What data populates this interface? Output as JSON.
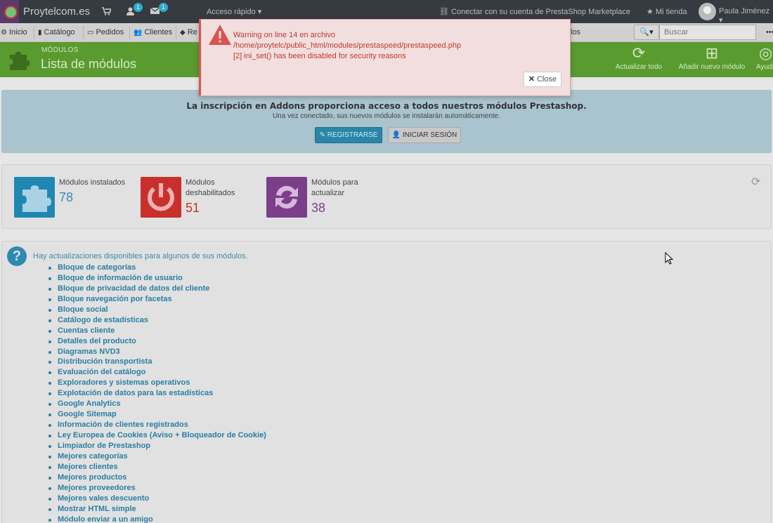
{
  "header": {
    "shop_name": "Proytelcom.es",
    "customers_badge": "1",
    "messages_badge": "1",
    "quick_access": "Acceso rápido",
    "connect": "Conectar con su cuenta de PrestaShop Marketplace",
    "my_store": "Mi tienda",
    "user": "Paula Jiménez"
  },
  "menu": {
    "items": [
      {
        "label": "Inicio",
        "icon": "home-icon"
      },
      {
        "label": "Catálogo",
        "icon": "book-icon"
      },
      {
        "label": "Pedidos",
        "icon": "credit-card-icon"
      },
      {
        "label": "Clientes",
        "icon": "users-icon"
      },
      {
        "label": "Re",
        "icon": "tags-icon"
      }
    ],
    "tail_label": "los",
    "search_placeholder": "Buscar"
  },
  "page": {
    "breadcrumb": "MÓDULOS",
    "title": "Lista de módulos",
    "actions": [
      {
        "label": "Actualizar todo",
        "icon": "refresh-icon"
      },
      {
        "label": "Añadir nuevo módulo",
        "icon": "plus-square-icon"
      },
      {
        "label": "Ayuda",
        "icon": "lifebuoy-icon"
      }
    ]
  },
  "addons": {
    "headline": "La inscripción en Addons proporciona acceso a todos nuestros módulos Prestashop.",
    "subline": "Una vez conectado, sus nuevos módulos se instalarán automáticamente.",
    "register": "REGISTRARSE",
    "login": "INICIAR SESIÓN"
  },
  "kpis": [
    {
      "label": "Módulos instalados",
      "value": "78",
      "color": "#1e87b2",
      "icon": "puzzle-icon"
    },
    {
      "label": "Módulos deshabilitados",
      "value": "51",
      "color": "#c9302c",
      "icon": "power-icon"
    },
    {
      "label": "Módulos para actualizar",
      "value": "38",
      "color": "#7b3f8a",
      "icon": "refresh-icon"
    }
  ],
  "updates": {
    "intro": "Hay actualizaciones disponibles para algunos de sus módulos.",
    "modules": [
      "Bloque de categorías",
      "Bloque de información de usuario",
      "Bloque de privacidad de datos del cliente",
      "Bloque navegación por facetas",
      "Bloque social",
      "Catálogo de estadísticas",
      "Cuentas cliente",
      "Detalles del producto",
      "Diagramas NVD3",
      "Distribución transportista",
      "Evaluación del catálogo",
      "Exploradores y sistemas operativos",
      "Explotación de datos para las estadísticas",
      "Google Analytics",
      "Google Sitemap",
      "Información de clientes registrados",
      "Ley Europea de Cookies (Aviso + Bloqueador de Cookie)",
      "Limpiador de Prestashop",
      "Mejores categorías",
      "Mejores clientes",
      "Mejores productos",
      "Mejores proveedores",
      "Mejores vales descuento",
      "Mostrar HTML simple",
      "Módulo enviar a un amigo"
    ]
  },
  "modal": {
    "line1": "Warning on line 14 en archivo",
    "line2": "/home/proytelc/public_html/modules/prestaspeed/prestaspeed.php",
    "line3": "[2] ini_set() has been disabled for security reasons",
    "close": "Close"
  }
}
